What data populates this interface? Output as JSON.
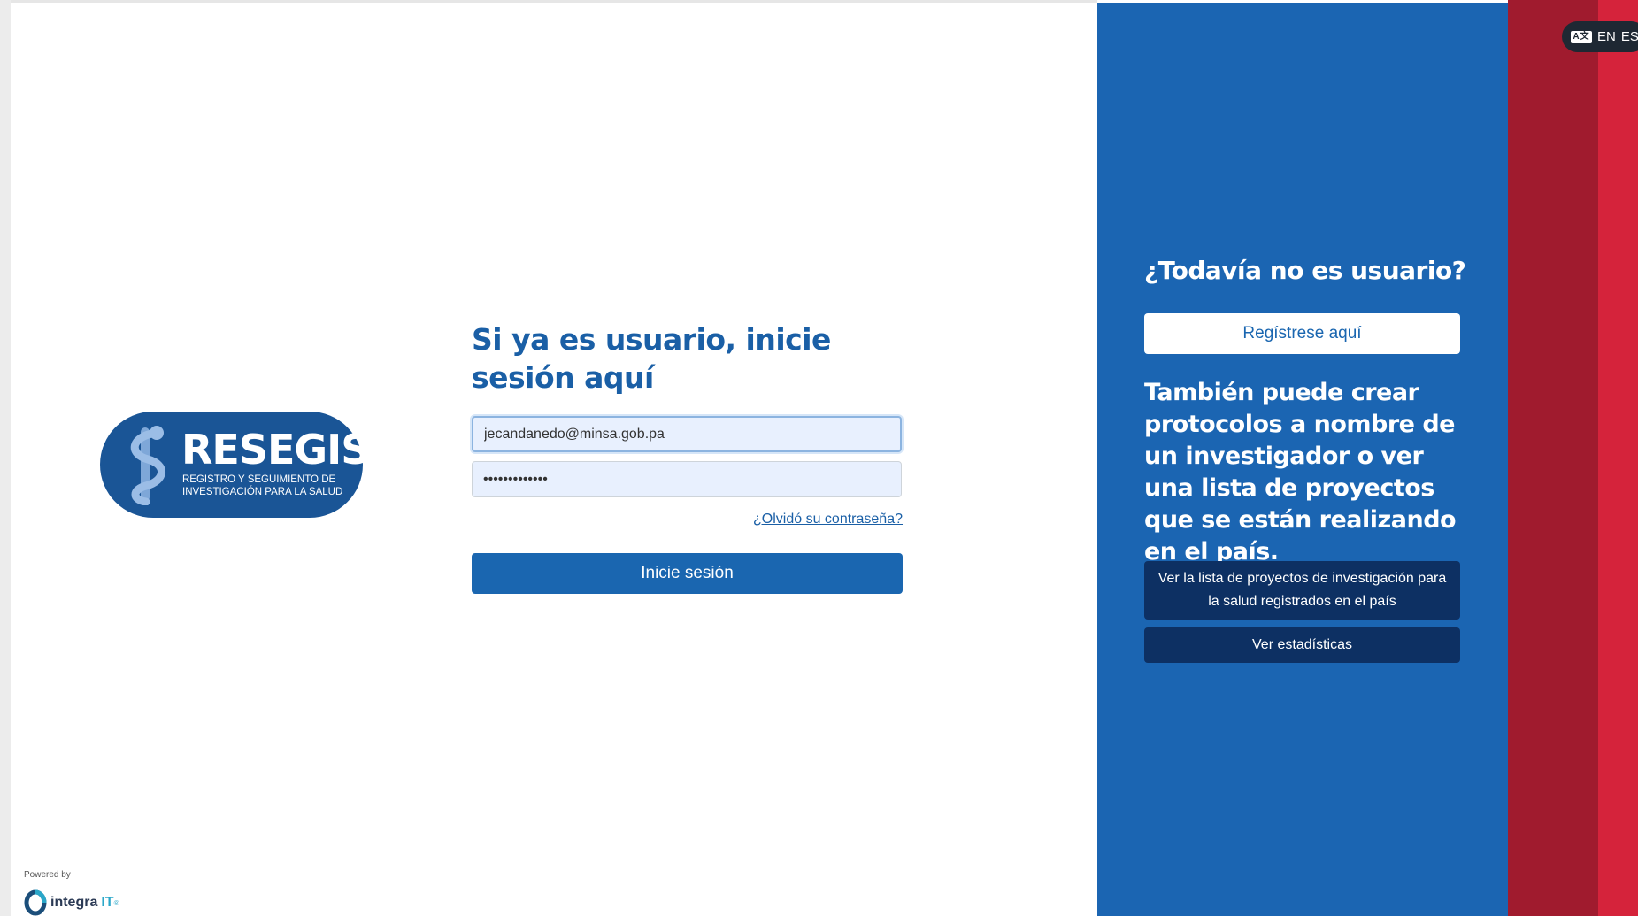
{
  "brand": {
    "logo_title": "RESEGIS",
    "logo_subtitle_line1": "REGISTRO Y SEGUIMIENTO DE",
    "logo_subtitle_line2": "INVESTIGACIÓN PARA LA SALUD"
  },
  "login": {
    "title": "Si ya es usuario, inicie sesión aquí",
    "email_value": "jecandanedo@minsa.gob.pa",
    "password_value": "•••••••••••••",
    "forgot_label": "¿Olvidó su contraseña?",
    "submit_label": "Inicie sesión"
  },
  "language": {
    "icon": "translate-icon",
    "options": [
      "EN",
      "ES"
    ]
  },
  "signup": {
    "title": "¿Todavía no es usuario?",
    "register_label": "Regístrese aquí",
    "also_text": "También puede crear protocolos a nombre de un investigador o ver una lista de proyectos que se están realizando en el país.",
    "projects_button": "Ver la lista de proyectos de investigación para la salud registrados en el país",
    "stats_button": "Ver estadísticas"
  },
  "footer": {
    "powered_by": "Powered by",
    "company": "integra",
    "company_suffix": "IT",
    "registered": "®"
  },
  "colors": {
    "primary_blue": "#1b65b2",
    "dark_blue": "#0d3063",
    "red": "#d5233b",
    "dark_red": "#a01b2e"
  }
}
